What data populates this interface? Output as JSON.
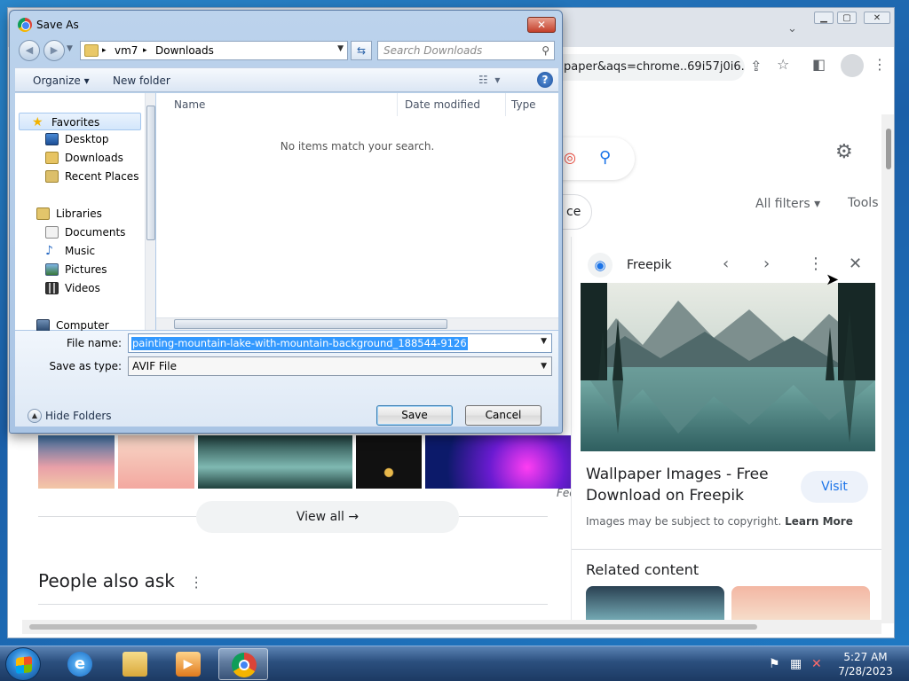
{
  "dialog": {
    "title": "Save As",
    "close_glyph": "✕",
    "address": {
      "segments": [
        "vm7",
        "Downloads"
      ],
      "separator": "▸"
    },
    "search_placeholder": "Search Downloads",
    "toolbar": {
      "organize": "Organize ▾",
      "new_folder": "New folder",
      "help": "?"
    },
    "nav": {
      "favorites": "Favorites",
      "desktop": "Desktop",
      "downloads": "Downloads",
      "recent": "Recent Places",
      "libraries": "Libraries",
      "documents": "Documents",
      "music": "Music",
      "pictures": "Pictures",
      "videos": "Videos",
      "computer": "Computer"
    },
    "columns": {
      "name": "Name",
      "date": "Date modified",
      "type": "Type"
    },
    "empty_message": "No items match your search.",
    "file_name_label": "File name:",
    "file_name_value": "painting-mountain-lake-with-mountain-background_188544-9126",
    "save_type_label": "Save as type:",
    "save_type_value": "AVIF File",
    "hide_folders": "Hide Folders",
    "save_button": "Save",
    "cancel_button": "Cancel"
  },
  "browser": {
    "url_fragment": "paper&aqs=chrome..69i57j0i6...",
    "filters": {
      "chip": "ce",
      "all_filters": "All filters ▾",
      "tools": "Tools"
    },
    "view_all": "View all",
    "people_also_ask": "People also ask",
    "source_prefix": "Fee",
    "side_panel": {
      "source": "Freepik",
      "title": "Wallpaper Images - Free Download on Freepik",
      "visit": "Visit",
      "note": "Images may be subject to copyright.",
      "learn_more": "Learn More",
      "related": "Related content"
    }
  },
  "taskbar": {
    "time": "5:27 AM",
    "date": "7/28/2023"
  },
  "colors": {
    "accent": "#1a73e8",
    "selection": "#3399ff",
    "taskbar": "#2b4f7e"
  }
}
